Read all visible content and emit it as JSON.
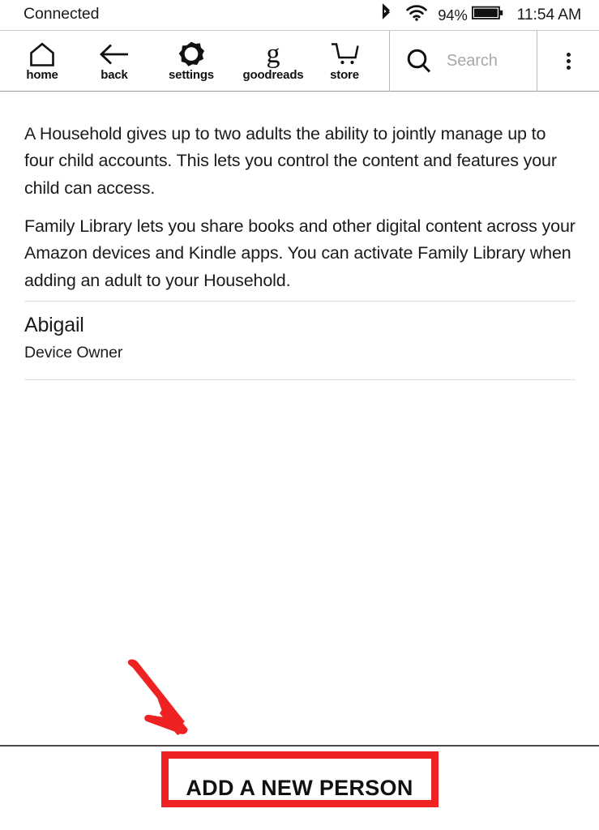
{
  "status_bar": {
    "connection_label": "Connected",
    "bluetooth_icon": "bluetooth-icon",
    "wifi_icon": "wifi-icon",
    "battery_percent": "94%",
    "battery_icon": "battery-full-icon",
    "time": "11:54 AM"
  },
  "toolbar": {
    "items": [
      {
        "label": "home",
        "icon": "home-icon"
      },
      {
        "label": "back",
        "icon": "arrow-left-icon"
      },
      {
        "label": "settings",
        "icon": "gear-icon"
      },
      {
        "label": "goodreads",
        "icon": "goodreads-g-icon"
      },
      {
        "label": "store",
        "icon": "shopping-cart-icon"
      }
    ],
    "search": {
      "icon": "search-icon",
      "placeholder": "Search",
      "value": ""
    },
    "menu_icon": "overflow-menu-icon"
  },
  "content": {
    "paragraph_1": "A Household gives up to two adults the ability to jointly manage up to four child accounts. This lets you control the content and features your child can access.",
    "paragraph_2": "Family Library lets you share books and other digital content across your Amazon devices and Kindle apps. You can activate Family Library when adding an adult to your Household.",
    "people": [
      {
        "name": "Abigail",
        "role": "Device Owner"
      }
    ]
  },
  "bottom_bar": {
    "add_person_label": "ADD A NEW PERSON"
  },
  "annotations": {
    "highlight_color": "#ee2222",
    "arrow_icon": "red-arrow-down-right-icon",
    "box_target": "add-a-new-person-button"
  }
}
